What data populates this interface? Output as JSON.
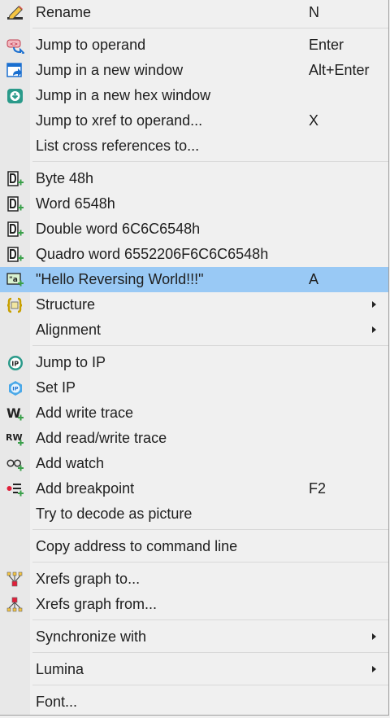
{
  "menu": {
    "items": [
      {
        "label": "Rename",
        "shortcut": "N",
        "icon": "rename-pencil-icon"
      },
      {
        "label": "Jump to operand",
        "shortcut": "Enter",
        "icon": "jump-operand-icon"
      },
      {
        "label": "Jump in a new window",
        "shortcut": "Alt+Enter",
        "icon": "new-window-icon"
      },
      {
        "label": "Jump in a new hex window",
        "shortcut": "",
        "icon": "hex-window-icon"
      },
      {
        "label": "Jump to xref to operand...",
        "shortcut": "X",
        "icon": ""
      },
      {
        "label": "List cross references to...",
        "shortcut": "",
        "icon": ""
      },
      {
        "label": "Byte 48h",
        "shortcut": "",
        "icon": "data-byte-icon"
      },
      {
        "label": "Word 6548h",
        "shortcut": "",
        "icon": "data-word-icon"
      },
      {
        "label": "Double word 6C6C6548h",
        "shortcut": "",
        "icon": "data-dword-icon"
      },
      {
        "label": "Quadro word 6552206F6C6C6548h",
        "shortcut": "",
        "icon": "data-qword-icon"
      },
      {
        "label": "\"Hello Reversing World!!!\"",
        "shortcut": "A",
        "icon": "string-icon",
        "highlighted": true
      },
      {
        "label": "Structure",
        "shortcut": "",
        "icon": "structure-icon",
        "submenu": true
      },
      {
        "label": "Alignment",
        "shortcut": "",
        "icon": "",
        "submenu": true
      },
      {
        "label": "Jump to IP",
        "shortcut": "",
        "icon": "jump-ip-icon"
      },
      {
        "label": "Set IP",
        "shortcut": "",
        "icon": "set-ip-icon"
      },
      {
        "label": "Add write trace",
        "shortcut": "",
        "icon": "write-trace-icon"
      },
      {
        "label": "Add read/write trace",
        "shortcut": "",
        "icon": "read-write-trace-icon"
      },
      {
        "label": "Add watch",
        "shortcut": "",
        "icon": "watch-glasses-icon"
      },
      {
        "label": "Add breakpoint",
        "shortcut": "F2",
        "icon": "breakpoint-icon"
      },
      {
        "label": "Try to decode as picture",
        "shortcut": "",
        "icon": ""
      },
      {
        "label": "Copy address to command line",
        "shortcut": "",
        "icon": ""
      },
      {
        "label": "Xrefs graph to...",
        "shortcut": "",
        "icon": "xrefs-graph-to-icon"
      },
      {
        "label": "Xrefs graph from...",
        "shortcut": "",
        "icon": "xrefs-graph-from-icon"
      },
      {
        "label": "Synchronize with",
        "shortcut": "",
        "icon": "",
        "submenu": true
      },
      {
        "label": "Lumina",
        "shortcut": "",
        "icon": "",
        "submenu": true
      },
      {
        "label": "Font...",
        "shortcut": "",
        "icon": ""
      }
    ]
  },
  "colors": {
    "menu_background": "#f0f0f0",
    "highlight": "#99c9f5",
    "separator": "#d8d8d8",
    "icon_green": "#3aa04a",
    "icon_teal": "#2a9a8a"
  }
}
